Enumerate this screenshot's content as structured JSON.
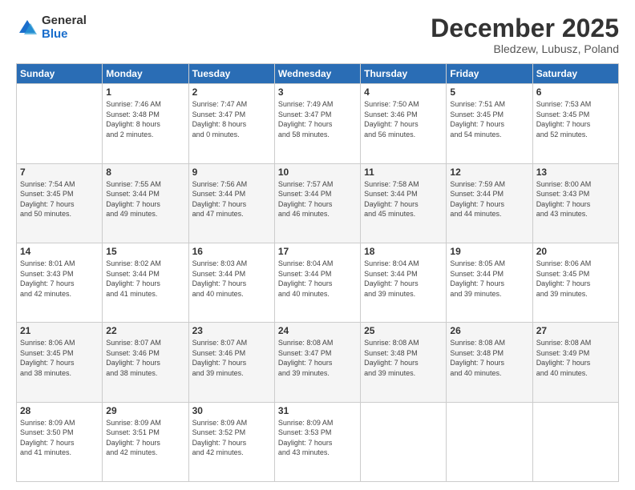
{
  "logo": {
    "general": "General",
    "blue": "Blue"
  },
  "header": {
    "month": "December 2025",
    "location": "Bledzew, Lubusz, Poland"
  },
  "days_of_week": [
    "Sunday",
    "Monday",
    "Tuesday",
    "Wednesday",
    "Thursday",
    "Friday",
    "Saturday"
  ],
  "weeks": [
    [
      {
        "day": "",
        "info": ""
      },
      {
        "day": "1",
        "info": "Sunrise: 7:46 AM\nSunset: 3:48 PM\nDaylight: 8 hours\nand 2 minutes."
      },
      {
        "day": "2",
        "info": "Sunrise: 7:47 AM\nSunset: 3:47 PM\nDaylight: 8 hours\nand 0 minutes."
      },
      {
        "day": "3",
        "info": "Sunrise: 7:49 AM\nSunset: 3:47 PM\nDaylight: 7 hours\nand 58 minutes."
      },
      {
        "day": "4",
        "info": "Sunrise: 7:50 AM\nSunset: 3:46 PM\nDaylight: 7 hours\nand 56 minutes."
      },
      {
        "day": "5",
        "info": "Sunrise: 7:51 AM\nSunset: 3:45 PM\nDaylight: 7 hours\nand 54 minutes."
      },
      {
        "day": "6",
        "info": "Sunrise: 7:53 AM\nSunset: 3:45 PM\nDaylight: 7 hours\nand 52 minutes."
      }
    ],
    [
      {
        "day": "7",
        "info": "Sunrise: 7:54 AM\nSunset: 3:45 PM\nDaylight: 7 hours\nand 50 minutes."
      },
      {
        "day": "8",
        "info": "Sunrise: 7:55 AM\nSunset: 3:44 PM\nDaylight: 7 hours\nand 49 minutes."
      },
      {
        "day": "9",
        "info": "Sunrise: 7:56 AM\nSunset: 3:44 PM\nDaylight: 7 hours\nand 47 minutes."
      },
      {
        "day": "10",
        "info": "Sunrise: 7:57 AM\nSunset: 3:44 PM\nDaylight: 7 hours\nand 46 minutes."
      },
      {
        "day": "11",
        "info": "Sunrise: 7:58 AM\nSunset: 3:44 PM\nDaylight: 7 hours\nand 45 minutes."
      },
      {
        "day": "12",
        "info": "Sunrise: 7:59 AM\nSunset: 3:44 PM\nDaylight: 7 hours\nand 44 minutes."
      },
      {
        "day": "13",
        "info": "Sunrise: 8:00 AM\nSunset: 3:43 PM\nDaylight: 7 hours\nand 43 minutes."
      }
    ],
    [
      {
        "day": "14",
        "info": "Sunrise: 8:01 AM\nSunset: 3:43 PM\nDaylight: 7 hours\nand 42 minutes."
      },
      {
        "day": "15",
        "info": "Sunrise: 8:02 AM\nSunset: 3:44 PM\nDaylight: 7 hours\nand 41 minutes."
      },
      {
        "day": "16",
        "info": "Sunrise: 8:03 AM\nSunset: 3:44 PM\nDaylight: 7 hours\nand 40 minutes."
      },
      {
        "day": "17",
        "info": "Sunrise: 8:04 AM\nSunset: 3:44 PM\nDaylight: 7 hours\nand 40 minutes."
      },
      {
        "day": "18",
        "info": "Sunrise: 8:04 AM\nSunset: 3:44 PM\nDaylight: 7 hours\nand 39 minutes."
      },
      {
        "day": "19",
        "info": "Sunrise: 8:05 AM\nSunset: 3:44 PM\nDaylight: 7 hours\nand 39 minutes."
      },
      {
        "day": "20",
        "info": "Sunrise: 8:06 AM\nSunset: 3:45 PM\nDaylight: 7 hours\nand 39 minutes."
      }
    ],
    [
      {
        "day": "21",
        "info": "Sunrise: 8:06 AM\nSunset: 3:45 PM\nDaylight: 7 hours\nand 38 minutes."
      },
      {
        "day": "22",
        "info": "Sunrise: 8:07 AM\nSunset: 3:46 PM\nDaylight: 7 hours\nand 38 minutes."
      },
      {
        "day": "23",
        "info": "Sunrise: 8:07 AM\nSunset: 3:46 PM\nDaylight: 7 hours\nand 39 minutes."
      },
      {
        "day": "24",
        "info": "Sunrise: 8:08 AM\nSunset: 3:47 PM\nDaylight: 7 hours\nand 39 minutes."
      },
      {
        "day": "25",
        "info": "Sunrise: 8:08 AM\nSunset: 3:48 PM\nDaylight: 7 hours\nand 39 minutes."
      },
      {
        "day": "26",
        "info": "Sunrise: 8:08 AM\nSunset: 3:48 PM\nDaylight: 7 hours\nand 40 minutes."
      },
      {
        "day": "27",
        "info": "Sunrise: 8:08 AM\nSunset: 3:49 PM\nDaylight: 7 hours\nand 40 minutes."
      }
    ],
    [
      {
        "day": "28",
        "info": "Sunrise: 8:09 AM\nSunset: 3:50 PM\nDaylight: 7 hours\nand 41 minutes."
      },
      {
        "day": "29",
        "info": "Sunrise: 8:09 AM\nSunset: 3:51 PM\nDaylight: 7 hours\nand 42 minutes."
      },
      {
        "day": "30",
        "info": "Sunrise: 8:09 AM\nSunset: 3:52 PM\nDaylight: 7 hours\nand 42 minutes."
      },
      {
        "day": "31",
        "info": "Sunrise: 8:09 AM\nSunset: 3:53 PM\nDaylight: 7 hours\nand 43 minutes."
      },
      {
        "day": "",
        "info": ""
      },
      {
        "day": "",
        "info": ""
      },
      {
        "day": "",
        "info": ""
      }
    ]
  ]
}
